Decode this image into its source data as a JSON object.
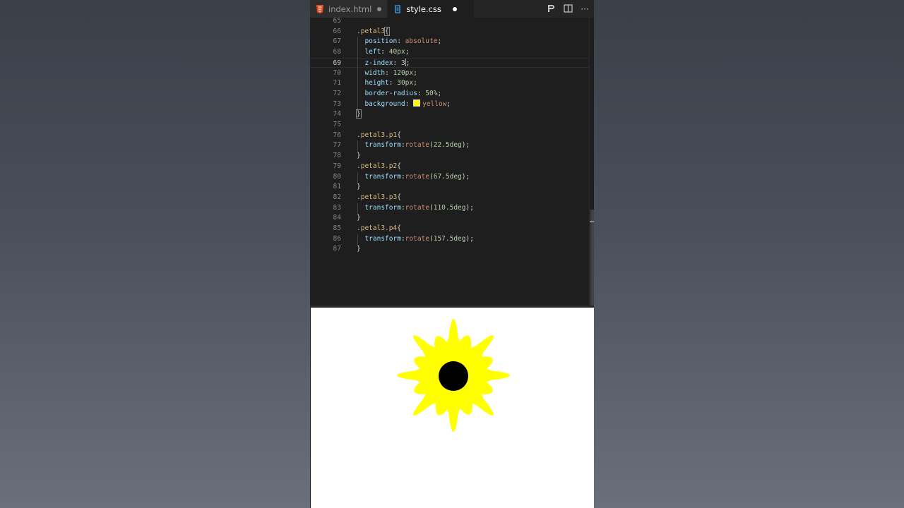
{
  "tabs": [
    {
      "label": "index.html",
      "icon": "html5-icon",
      "active": false,
      "modified": true
    },
    {
      "label": "style.css",
      "icon": "css3-icon",
      "active": true,
      "modified": true
    }
  ],
  "actions": {
    "run_icon": "P",
    "split_icon": "split-editor-icon",
    "more": "···"
  },
  "code_lines": [
    {
      "n": "65",
      "html": ""
    },
    {
      "n": "66",
      "html": "<span class='sel'>.petal3</span><span class='punc bracket-hl'>{</span>"
    },
    {
      "n": "67",
      "html": "  <span class='prop'>position</span><span class='punc'>: </span><span class='val'>absolute</span><span class='punc'>;</span>"
    },
    {
      "n": "68",
      "html": "  <span class='prop'>left</span><span class='punc'>: </span><span class='num'>40px</span><span class='punc'>;</span>"
    },
    {
      "n": "69",
      "html": "  <span class='prop'>z-index</span><span class='punc'>: </span><span class='num'>3</span><span class='cursor-caret'></span><span class='punc'>;</span>",
      "current": true
    },
    {
      "n": "70",
      "html": "  <span class='prop'>width</span><span class='punc'>: </span><span class='num'>120px</span><span class='punc'>;</span>"
    },
    {
      "n": "71",
      "html": "  <span class='prop'>height</span><span class='punc'>: </span><span class='num'>30px</span><span class='punc'>;</span>"
    },
    {
      "n": "72",
      "html": "  <span class='prop'>border-radius</span><span class='punc'>: </span><span class='num'>50%</span><span class='punc'>;</span>"
    },
    {
      "n": "73",
      "html": "  <span class='prop'>background</span><span class='punc'>: </span><span class='swatch'></span><span class='val'>yellow</span><span class='punc'>;</span>"
    },
    {
      "n": "74",
      "html": "<span class='punc bracket-hl'>}</span>"
    },
    {
      "n": "75",
      "html": ""
    },
    {
      "n": "76",
      "html": "<span class='sel'>.petal3.p1</span><span class='punc'>{</span>"
    },
    {
      "n": "77",
      "html": "  <span class='prop'>transform</span><span class='punc'>:</span><span class='val'>rotate</span><span class='punc'>(</span><span class='num'>22.5deg</span><span class='punc'>);</span>"
    },
    {
      "n": "78",
      "html": "<span class='punc'>}</span>"
    },
    {
      "n": "79",
      "html": "<span class='sel'>.petal3.p2</span><span class='punc'>{</span>"
    },
    {
      "n": "80",
      "html": "  <span class='prop'>transform</span><span class='punc'>:</span><span class='val'>rotate</span><span class='punc'>(</span><span class='num'>67.5deg</span><span class='punc'>);</span>"
    },
    {
      "n": "81",
      "html": "<span class='punc'>}</span>"
    },
    {
      "n": "82",
      "html": "<span class='sel'>.petal3.p3</span><span class='punc'>{</span>"
    },
    {
      "n": "83",
      "html": "  <span class='prop'>transform</span><span class='punc'>:</span><span class='val'>rotate</span><span class='punc'>(</span><span class='num'>110.5deg</span><span class='punc'>);</span>"
    },
    {
      "n": "84",
      "html": "<span class='punc'>}</span>"
    },
    {
      "n": "85",
      "html": "<span class='sel'>.petal3.p4</span><span class='punc'>{</span>"
    },
    {
      "n": "86",
      "html": "  <span class='prop'>transform</span><span class='punc'>:</span><span class='val'>rotate</span><span class='punc'>(</span><span class='num'>157.5deg</span><span class='punc'>);</span>"
    },
    {
      "n": "87",
      "html": "<span class='punc'>}</span>"
    }
  ],
  "preview": {
    "flower_color": "#ffff00",
    "center_color": "#000000",
    "petal_angles_deg": [
      0,
      45,
      90,
      135,
      22.5,
      67.5,
      110.5,
      157.5
    ],
    "big_petal_angles_deg": [
      0,
      45,
      90,
      135
    ]
  }
}
